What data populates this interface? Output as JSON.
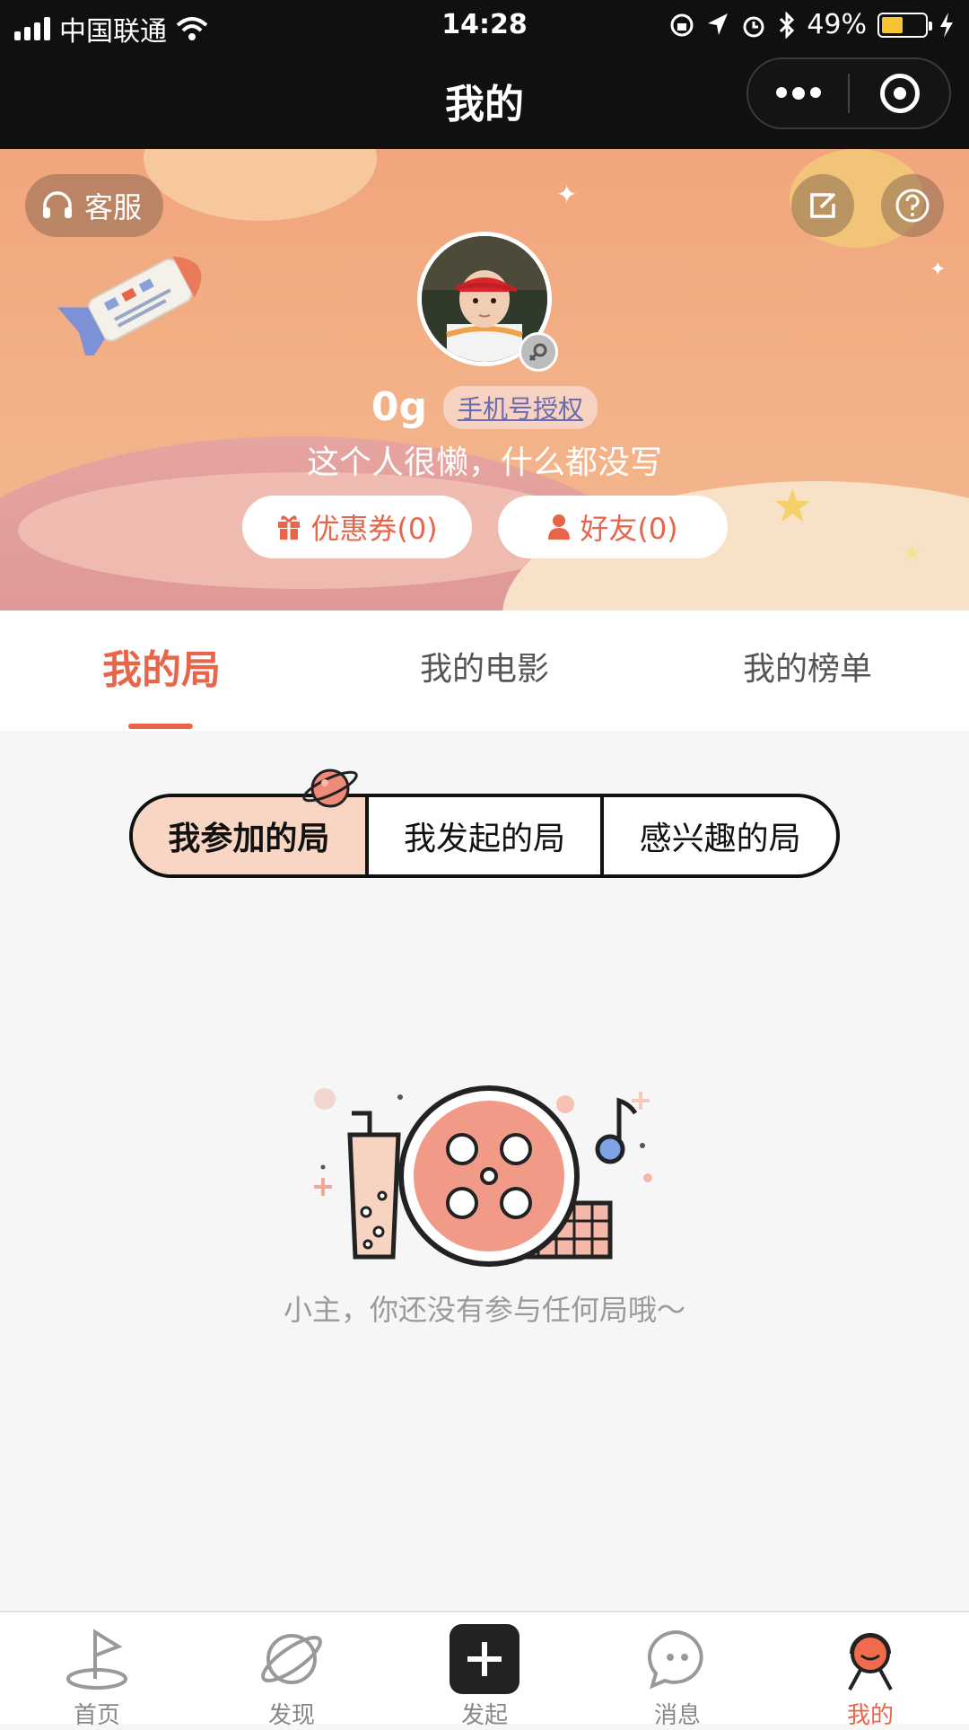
{
  "status_bar": {
    "carrier": "中国联通",
    "time": "14:28",
    "battery": "49%",
    "battery_level": 0.49,
    "battery_color": "#f6c431"
  },
  "nav": {
    "title": "我的",
    "more_icon": "more-dots-icon",
    "close_icon": "target-icon"
  },
  "header": {
    "kefu_label": "客服",
    "edit_icon": "edit-icon",
    "help_icon": "help-icon",
    "username": "0g",
    "auth_badge": "手机号授权",
    "bio": "这个人很懒，什么都没写",
    "coupon_label": "优惠券(0)",
    "friends_label": "好友(0)"
  },
  "tabs": [
    {
      "label": "我的局",
      "active": true
    },
    {
      "label": "我的电影",
      "active": false
    },
    {
      "label": "我的榜单",
      "active": false
    }
  ],
  "segments": [
    {
      "label": "我参加的局",
      "active": true
    },
    {
      "label": "我发起的局",
      "active": false
    },
    {
      "label": "感兴趣的局",
      "active": false
    }
  ],
  "empty_state": {
    "message": "小主，你还没有参与任何局哦～"
  },
  "bottom_nav": [
    {
      "label": "首页",
      "icon": "golf-flag-icon",
      "active": false
    },
    {
      "label": "发现",
      "icon": "planet-icon",
      "active": false
    },
    {
      "label": "发起",
      "icon": "plus-icon",
      "active": false
    },
    {
      "label": "消息",
      "icon": "chat-bubble-icon",
      "active": false
    },
    {
      "label": "我的",
      "icon": "profile-icon",
      "active": true
    }
  ],
  "colors": {
    "accent": "#e9654a",
    "banner": "#f2a57c",
    "segment_active": "#f9d5c4"
  }
}
